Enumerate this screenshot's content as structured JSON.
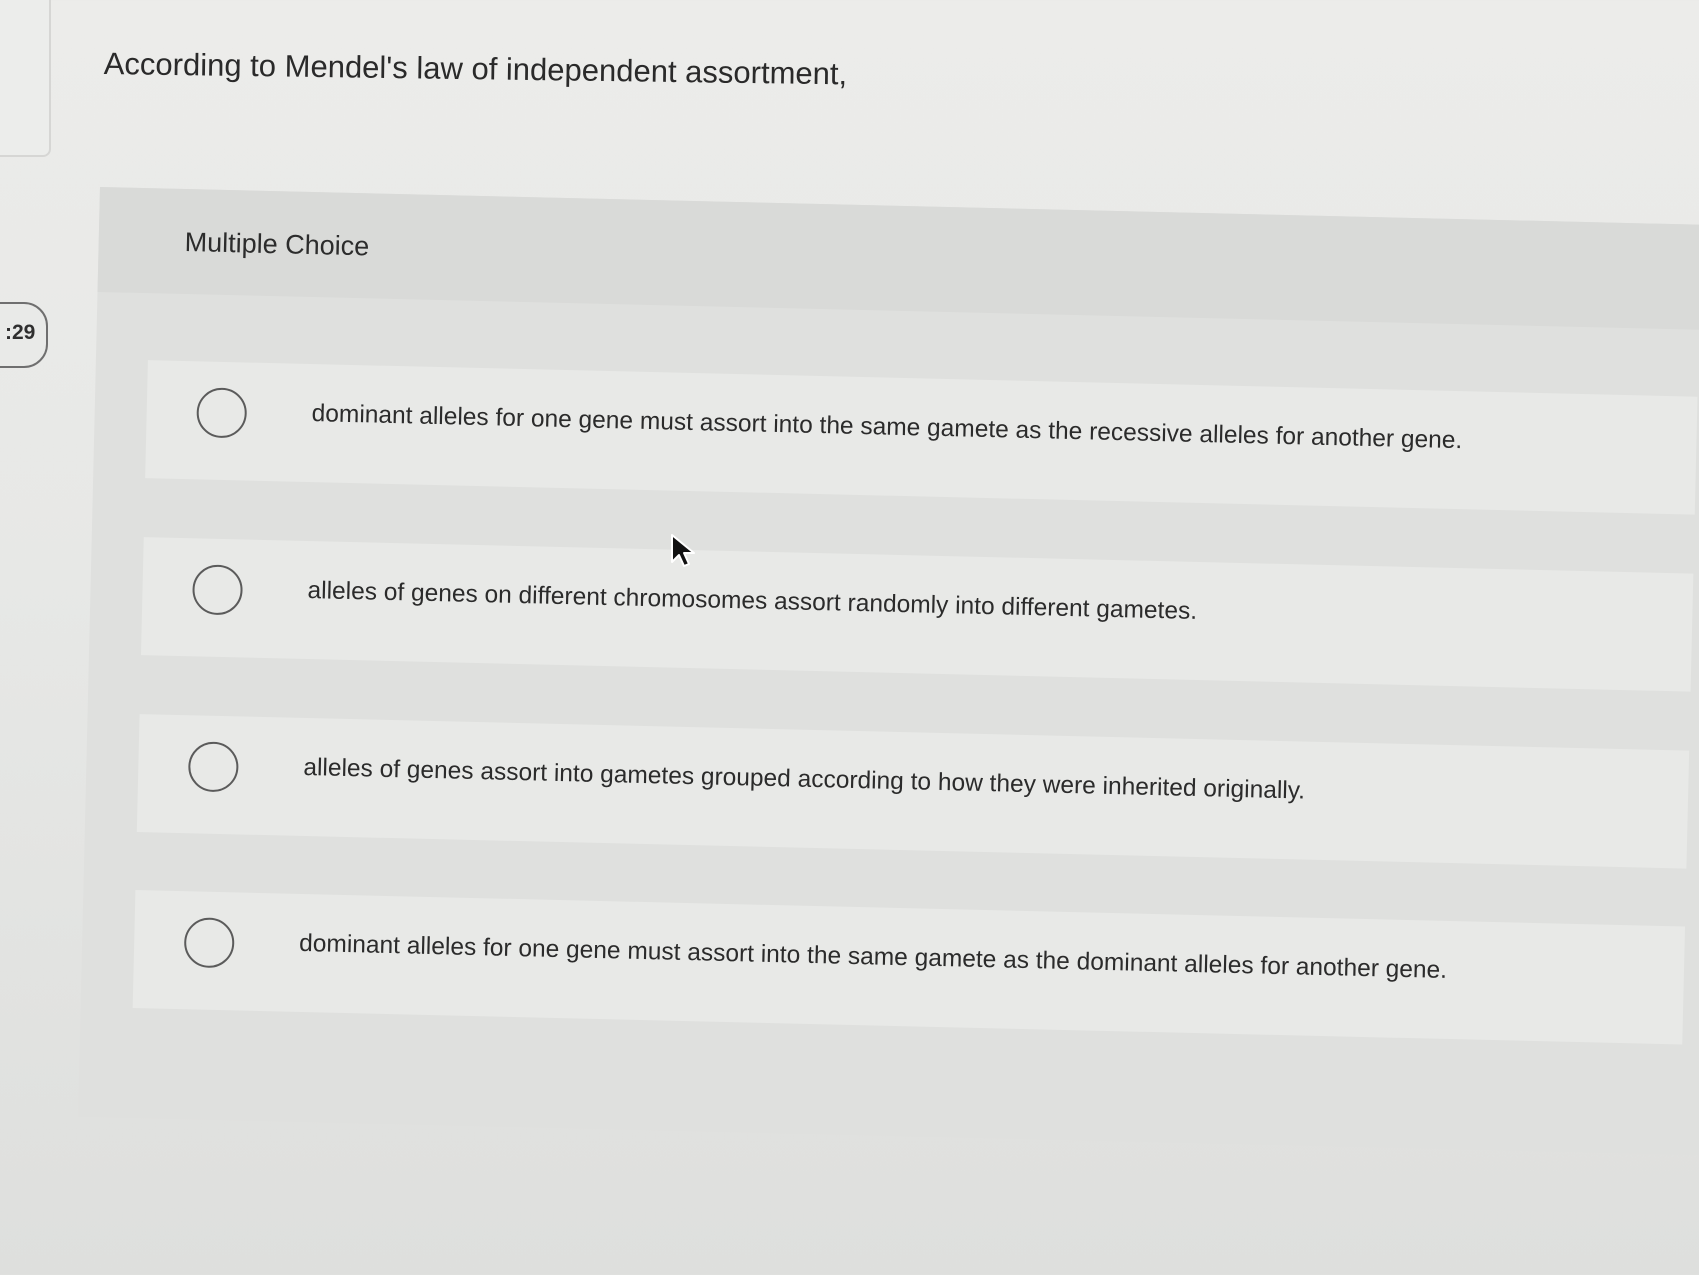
{
  "timer": {
    "text": ":29"
  },
  "question": {
    "text": "According to Mendel's law of independent assortment,"
  },
  "multiple_choice": {
    "title": "Multiple Choice",
    "options": [
      {
        "label": "dominant alleles for one gene must assort into the same gamete as the recessive alleles for another gene.",
        "selected": false
      },
      {
        "label": "alleles of genes on different chromosomes assort randomly into different gametes.",
        "selected": false
      },
      {
        "label": "alleles of genes assort into gametes grouped according to how they were inherited originally.",
        "selected": false
      },
      {
        "label": "dominant alleles for one gene must assort into the same gamete as the dominant alleles for another gene.",
        "selected": false
      }
    ]
  },
  "icons": {
    "cursor": "mouse-pointer-icon",
    "radio": "radio-button-icon"
  },
  "colors": {
    "background": "#e7e8e6",
    "panel": "#dfe0de",
    "option_background": "#e8e9e7",
    "text": "#2b2b2b"
  }
}
